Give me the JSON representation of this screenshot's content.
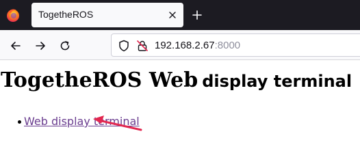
{
  "browser": {
    "tab": {
      "title": "TogetheROS"
    },
    "address": {
      "host": "192.168.2.67",
      "port": ":8000"
    },
    "accent_color": "#e22850"
  },
  "page": {
    "heading_part1": "TogetheROS Web",
    "heading_part2": "display terminal",
    "links": [
      {
        "label": "Web display terminal"
      }
    ],
    "link_color": "#6a3d8f"
  },
  "icons": {
    "browser_logo": "firefox-logo-icon",
    "tab_close": "close-icon",
    "new_tab": "plus-icon",
    "back": "arrow-left-icon",
    "forward": "arrow-right-icon",
    "reload": "reload-icon",
    "tracking": "shield-icon",
    "security": "insecure-lock-icon",
    "annotation": "red-arrow-icon"
  }
}
